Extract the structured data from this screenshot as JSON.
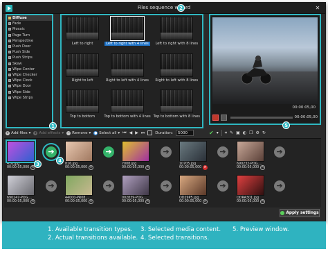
{
  "window": {
    "title": "Files sequence wizard",
    "close_label": "✕"
  },
  "types": [
    {
      "label": "Diffuse",
      "kind": "folder",
      "selected": true
    },
    {
      "label": "Fade",
      "kind": "film"
    },
    {
      "label": "Mosaic",
      "kind": "film"
    },
    {
      "label": "Page Turn",
      "kind": "film"
    },
    {
      "label": "Perspective",
      "kind": "film"
    },
    {
      "label": "Push Door",
      "kind": "film"
    },
    {
      "label": "Push Side",
      "kind": "film"
    },
    {
      "label": "Push Strips",
      "kind": "film"
    },
    {
      "label": "Skew",
      "kind": "film"
    },
    {
      "label": "Wipe Center",
      "kind": "film"
    },
    {
      "label": "Wipe Checker",
      "kind": "film"
    },
    {
      "label": "Wipe Clock",
      "kind": "film"
    },
    {
      "label": "Wipe Door",
      "kind": "film"
    },
    {
      "label": "Wipe Side",
      "kind": "film"
    },
    {
      "label": "Wipe Strips",
      "kind": "film"
    }
  ],
  "transitions": [
    {
      "label": "Left to right"
    },
    {
      "label": "Left to right with 4 lines",
      "selected": true
    },
    {
      "label": "Left to right with 8 lines"
    },
    {
      "label": "Right to left"
    },
    {
      "label": "Right to left with 4 lines"
    },
    {
      "label": "Right to left with 8 lines"
    },
    {
      "label": "Top to bottom"
    },
    {
      "label": "Top to bottom with 4 lines"
    },
    {
      "label": "Top to bottom with 8 lines"
    }
  ],
  "preview": {
    "time_top": "00:00:05,00",
    "time_bottom": "00:00:05,00"
  },
  "badges": {
    "b1": "1",
    "b2": "2",
    "b3": "3",
    "b4": "4",
    "b5": "5"
  },
  "toolbar": {
    "add_files": "Add files",
    "add_effects": "Add effects",
    "remove": "Remove",
    "select_all": "Select all",
    "duration_label": "Duration:",
    "duration_value": "5000"
  },
  "media_row1": [
    {
      "name": "416.jpg",
      "time": "00:00:05,000",
      "colors": [
        "#c050e0",
        "#3060d0"
      ]
    },
    {
      "name": "816.jpg",
      "time": "00:00:05,000",
      "colors": [
        "#e8c8b0",
        "#a07860"
      ]
    },
    {
      "name": "7008.jpg",
      "time": "00:00:05,000",
      "colors": [
        "#e0c030",
        "#a030a0"
      ]
    },
    {
      "name": "10705.jpg",
      "time": "00:00:05,000",
      "colors": [
        "#6a7a80",
        "#2a3038"
      ],
      "red": true
    },
    {
      "name": "690232-POG....",
      "time": "00:00:05,000",
      "colors": [
        "#c8a898",
        "#5a4038"
      ]
    }
  ],
  "media_row2": [
    {
      "name": "690247-POG....",
      "time": "00:00:05,000",
      "colors": [
        "#d0d0d8",
        "#6a6a70"
      ]
    },
    {
      "name": "44000-PR08....",
      "time": "00:00:05,000",
      "colors": [
        "#80a860",
        "#c8b890"
      ]
    },
    {
      "name": "002839-POG....",
      "time": "00:00:05,000",
      "colors": [
        "#b0a0c0",
        "#403848"
      ]
    },
    {
      "name": "OD29P5.jpg",
      "time": "00:00:05,000",
      "colors": [
        "#d8a880",
        "#5a3828"
      ]
    },
    {
      "name": "ODRA301.jpg",
      "time": "00:00:05,000",
      "colors": [
        "#e04040",
        "#301010"
      ]
    }
  ],
  "apply_label": "Apply settings",
  "legend": {
    "l1": "1. Available transition types.",
    "l2": "2. Actual transitions available.",
    "l3": "3. Selected media content.",
    "l4": "4. Selected transitions.",
    "l5": "5. Preview window."
  }
}
